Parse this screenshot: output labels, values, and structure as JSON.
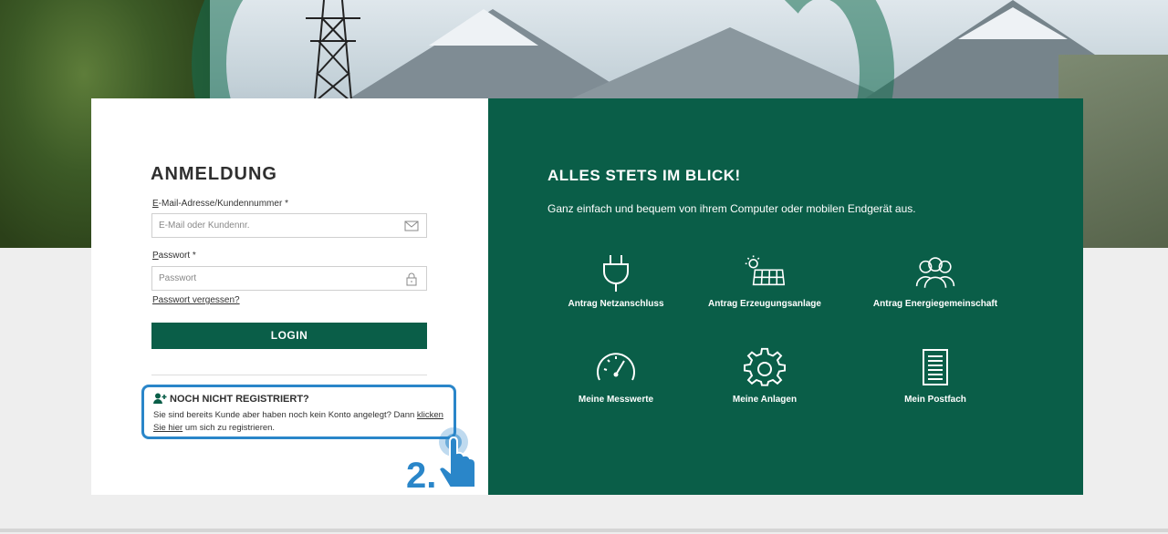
{
  "login": {
    "title": "ANMELDUNG",
    "email_label_u": "E",
    "email_label_rest": "-Mail-Adresse/Kundennummer",
    "required_mark": "*",
    "email_placeholder": "E-Mail oder Kundennr.",
    "password_label_u": "P",
    "password_label_rest": "asswort",
    "password_placeholder": "Passwort",
    "forgot_link": "Passwort vergessen?",
    "login_button": "LOGIN"
  },
  "register": {
    "title": "NOCH NICHT REGISTRIERT?",
    "text_before": "Sie sind bereits Kunde aber haben noch kein Konto angelegt? Dann ",
    "link": "klicken Sie hier",
    "text_after": " um sich zu registrieren.",
    "step_badge": "2."
  },
  "promo": {
    "title": "ALLES STETS IM BLICK!",
    "subtitle": "Ganz einfach und bequem von ihrem Computer oder mobilen Endgerät aus.",
    "features": [
      {
        "label": "Antrag Netzanschluss",
        "icon": "plug-icon"
      },
      {
        "label": "Antrag Erzeugungsanlage",
        "icon": "solar-panel-icon"
      },
      {
        "label": "Antrag Energiegemeinschaft",
        "icon": "community-icon"
      },
      {
        "label": "Meine Messwerte",
        "icon": "gauge-icon"
      },
      {
        "label": "Meine Anlagen",
        "icon": "gear-icon"
      },
      {
        "label": "Mein Postfach",
        "icon": "document-icon"
      }
    ]
  },
  "colors": {
    "brand_green": "#0a5e48",
    "highlight_blue": "#2a86c9",
    "text_dark": "#2f2f2f"
  }
}
